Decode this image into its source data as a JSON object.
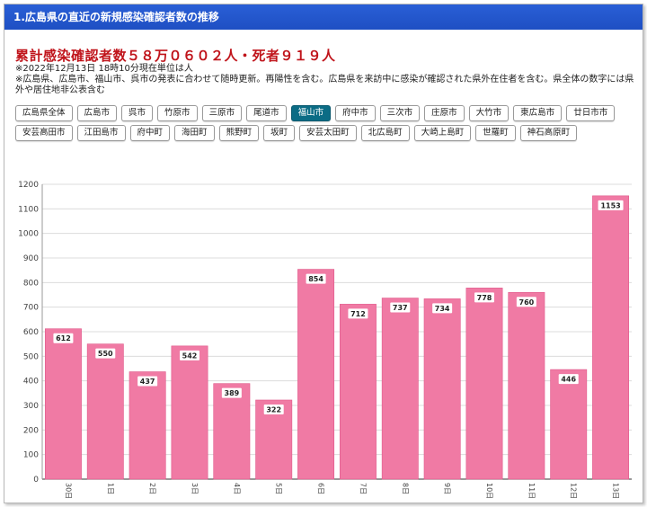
{
  "header": {
    "title": "1.広島県の直近の新規感染確認者数の推移"
  },
  "summary": {
    "title": "累計感染確認者数５８万０６０２人・死者９１９人",
    "note_line1": "※2022年12月13日 18時10分現在単位は人",
    "note_line2": "※広島県、広島市、福山市、呉市の発表に合わせて随時更新。再陽性を含む。広島県を来訪中に感染が確認された県外在住者を含む。県全体の数字には県外や居住地非公表含む"
  },
  "filters": {
    "active": "福山市",
    "items": [
      "広島県全体",
      "広島市",
      "呉市",
      "竹原市",
      "三原市",
      "尾道市",
      "福山市",
      "府中市",
      "三次市",
      "庄原市",
      "大竹市",
      "東広島市",
      "廿日市市",
      "安芸高田市",
      "江田島市",
      "府中町",
      "海田町",
      "熊野町",
      "坂町",
      "安芸太田町",
      "北広島町",
      "大崎上島町",
      "世羅町",
      "神石高原町"
    ]
  },
  "colors": {
    "bar": "#f07aa4",
    "bar_stroke": "#e0588a",
    "active_button": "#0b6c85",
    "header": "#1e4fc3",
    "title": "#c0141b"
  },
  "chart_data": {
    "type": "bar",
    "categories": [
      "30日",
      "1日",
      "2日",
      "3日",
      "4日",
      "5日",
      "6日",
      "7日",
      "8日",
      "9日",
      "10日",
      "11日",
      "12日",
      "13日"
    ],
    "values": [
      612,
      550,
      437,
      542,
      389,
      322,
      854,
      712,
      737,
      734,
      778,
      760,
      446,
      1153
    ],
    "ylim": [
      0,
      1200
    ],
    "yticks": [
      0,
      100,
      200,
      300,
      400,
      500,
      600,
      700,
      800,
      900,
      1000,
      1100,
      1200
    ],
    "grid": true,
    "data_labels": true
  }
}
